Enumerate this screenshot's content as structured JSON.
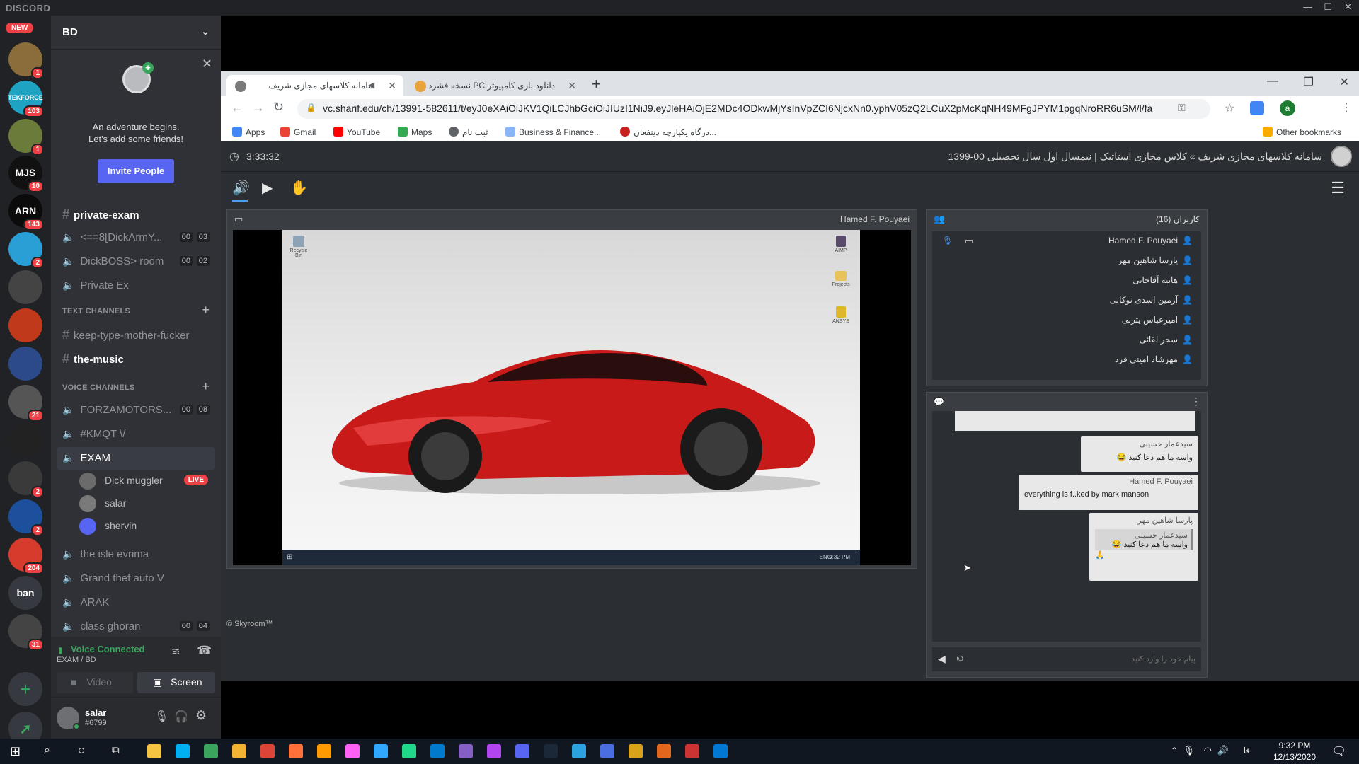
{
  "discord": {
    "brand": "DISCORD",
    "window_controls": [
      "—",
      "☐",
      "✕"
    ],
    "new_badge": "NEW",
    "servers": [
      {
        "label": "",
        "badge": "1",
        "color": "#8a6d3b"
      },
      {
        "label": "TEKFORCE",
        "badge": "103",
        "color": "#1fa3c2"
      },
      {
        "label": "",
        "badge": "1",
        "color": "#6b7b3a"
      },
      {
        "label": "MJS",
        "badge": "10",
        "color": "#111111"
      },
      {
        "label": "ARN",
        "badge": "143",
        "color": "#0b0b0b"
      },
      {
        "label": "",
        "badge": "2",
        "color": "#2a9fd6"
      },
      {
        "label": "",
        "badge": "",
        "color": "#444444"
      },
      {
        "label": "",
        "badge": "",
        "color": "#c0391b"
      },
      {
        "label": "",
        "badge": "",
        "color": "#2c4a8a"
      },
      {
        "label": "",
        "badge": "21",
        "color": "#555555"
      },
      {
        "label": "",
        "badge": "",
        "color": "#222222"
      },
      {
        "label": "",
        "badge": "2",
        "color": "#3a3a3a"
      },
      {
        "label": "",
        "badge": "2",
        "color": "#1c4f9c"
      },
      {
        "label": "",
        "badge": "204",
        "color": "#d63b2b"
      },
      {
        "label": "ban",
        "badge": "",
        "color": "#36393f"
      },
      {
        "label": "",
        "badge": "31",
        "color": "#444444"
      }
    ],
    "server_name": "BD",
    "friend_card": {
      "line1": "An adventure begins.",
      "line2": "Let's add some friends!",
      "invite_label": "Invite People"
    },
    "top_channels": [
      {
        "name": "private-exam",
        "type": "text",
        "bold": true
      },
      {
        "name": "<==8[DickArmY...",
        "type": "voice",
        "c1": "00",
        "c2": "03"
      },
      {
        "name": "DickBOSS> room",
        "type": "voice",
        "c1": "00",
        "c2": "02"
      },
      {
        "name": "Private Ex",
        "type": "voice"
      }
    ],
    "text_category": "TEXT CHANNELS",
    "text_channels": [
      {
        "name": "keep-type-mother-fucker",
        "bold": false
      },
      {
        "name": "the-music",
        "bold": true
      }
    ],
    "voice_category": "VOICE CHANNELS",
    "voice_channels": [
      {
        "name": "FORZAMOTORS...",
        "c1": "00",
        "c2": "08"
      },
      {
        "name": "#KMQT \\/"
      },
      {
        "name": "EXAM",
        "active": true
      }
    ],
    "exam_users": [
      {
        "name": "Dick muggler",
        "live": "LIVE"
      },
      {
        "name": "salar"
      },
      {
        "name": "shervin"
      }
    ],
    "more_voice_channels": [
      {
        "name": "the isle evrima"
      },
      {
        "name": "Grand thef auto V"
      },
      {
        "name": "ARAK"
      },
      {
        "name": "class ghoran",
        "c1": "00",
        "c2": "04"
      }
    ],
    "voice_status": {
      "title": "Voice Connected",
      "subtitle": "EXAM / BD",
      "video_label": "Video",
      "screen_label": "Screen"
    },
    "user": {
      "name": "salar",
      "tag": "#6799"
    }
  },
  "browser": {
    "tabs": [
      {
        "title": "سامانه کلاسهای مجازی شریف",
        "active": true
      },
      {
        "title": "دانلود بازی کامپیوتر PC نسخه فشرد",
        "active": false
      }
    ],
    "url": "vc.sharif.edu/ch/13991-582611/t/eyJ0eXAiOiJKV1QiLCJhbGciOiJIUzI1NiJ9.eyJleHAiOjE2MDc4ODkwMjYsInVpZCI6NjcxNn0.yphV05zQ2LCuX2pMcKqNH49MFgJPYM1pgqNroRR6uSM/l/fa",
    "bookmarks": [
      "Apps",
      "Gmail",
      "YouTube",
      "Maps",
      "ثبت نام",
      "Business & Finance...",
      "درگاه یکپارچه دینفعان..."
    ],
    "other_bookmarks": "Other bookmarks"
  },
  "skyroom": {
    "timer": "3:33:32",
    "title": "سامانه کلاسهای مجازی شریف » کلاس مجازی استاتیک | نیمسال اول سال تحصیلی 00-1399",
    "presenter": "Hamed F. Pouyaei",
    "users_title": "کاربران (16)",
    "users": [
      "Hamed F. Pouyaei",
      "پارسا شاهین مهر",
      "هانیه آقاخانی",
      "آرمین اسدی نوکانی",
      "امیرعباس یثربی",
      "سحر لقائی",
      "مهرشاد امینی فرد"
    ],
    "desktop_icons": [
      "Recycle Bin",
      "AIMP",
      "Projects",
      "ANSYS"
    ],
    "desktop_tray": {
      "lang": "ENG",
      "time": "9:32 PM"
    },
    "messages": [
      {
        "author": "سیدعمار حسینی",
        "text": "واسه ما هم دعا کنید 😂"
      },
      {
        "author": "Hamed F. Pouyaei",
        "text": "everything is f..ked by mark manson"
      },
      {
        "author": "پارسا شاهین مهر",
        "quote_author": "سیدعمار حسینی",
        "quote": "واسه ما هم دعا کنید 😂",
        "text": "🙏"
      }
    ],
    "chat_placeholder": "پیام خود را وارد کنید",
    "copyright": "© Skyroom™"
  },
  "taskbar": {
    "time": "9:32 PM",
    "date": "12/13/2020",
    "lang": "فا"
  }
}
